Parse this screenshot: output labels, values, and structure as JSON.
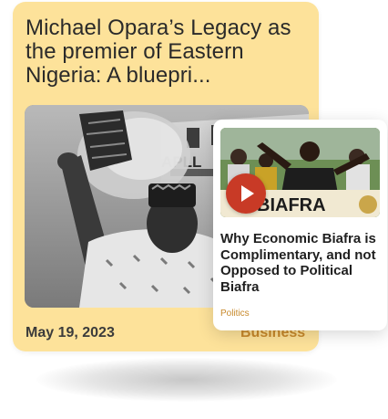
{
  "main_card": {
    "title": "Michael Opara’s Legacy as the premier of Eastern Nigeria: A bluepri...",
    "date": "May 19, 2023",
    "category": "Business",
    "photo_alt": "black-and-white portrait of a man in a patterned cap holding a feathered fan in front of an aircraft",
    "photo_text": "APLL"
  },
  "sub_card": {
    "title": "Why Economic Biafra is Complimentary, and not Opposed to Political Biafra",
    "category": "Politics",
    "photo_text": "BIAFRA"
  },
  "colors": {
    "main_card_bg": "#fde29a",
    "accent": "#c8892b",
    "play_button": "#c83a26",
    "title_text": "#2a2a2a"
  },
  "icons": {
    "play": "play-icon"
  }
}
